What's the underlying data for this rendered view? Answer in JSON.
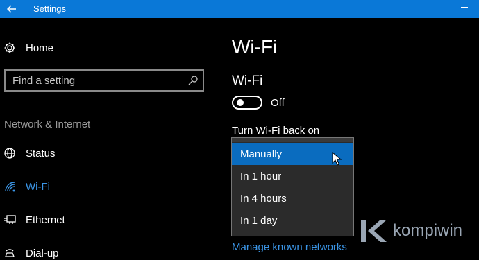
{
  "window": {
    "title": "Settings"
  },
  "sidebar": {
    "home_label": "Home",
    "search_placeholder": "Find a setting",
    "section_label": "Network & Internet",
    "items": [
      {
        "label": "Status",
        "icon": "globe-icon"
      },
      {
        "label": "Wi-Fi",
        "icon": "wifi-icon",
        "selected": true
      },
      {
        "label": "Ethernet",
        "icon": "ethernet-icon"
      },
      {
        "label": "Dial-up",
        "icon": "dialup-icon"
      }
    ]
  },
  "main": {
    "page_title": "Wi-Fi",
    "wifi_heading": "Wi-Fi",
    "toggle_state": "Off",
    "turn_back_label": "Turn Wi-Fi back on",
    "dropdown_options": [
      "Manually",
      "In 1 hour",
      "In 4 hours",
      "In 1 day"
    ],
    "dropdown_selected": "Manually",
    "manage_link": "Manage known networks"
  },
  "watermark": {
    "text": "kompiwin"
  },
  "colors": {
    "accent": "#0a78d7",
    "selected_option": "#0a6cbf",
    "link": "#3b95e6",
    "background": "#000000",
    "dropdown_bg": "#2b2b2b"
  }
}
